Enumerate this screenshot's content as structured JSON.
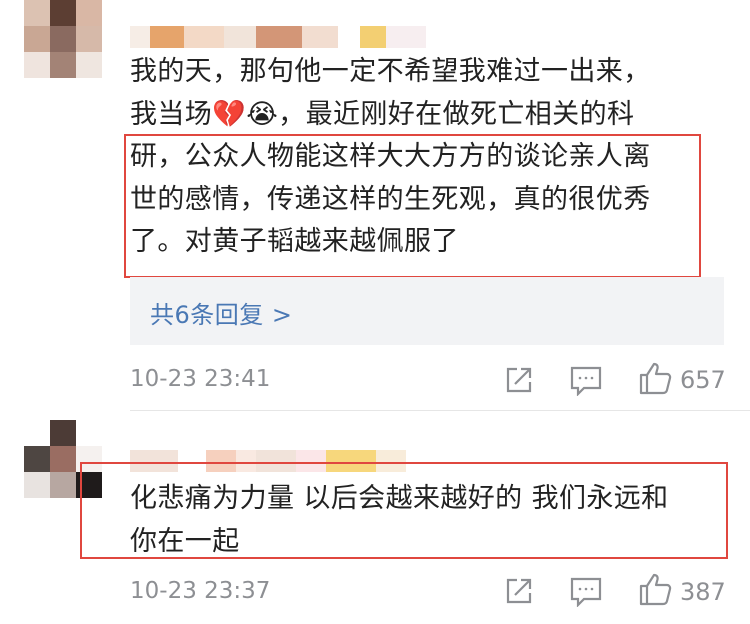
{
  "comments": [
    {
      "text_lines": [
        "我的天，那句他一定不希望我难过一出来，",
        "我当场💔😭，最近刚好在做死亡相关的科",
        "研，公众人物能这样大大方方的谈论亲人离",
        "世的感情，传递这样的生死观，真的很优秀",
        "了。对黄子韬越来越佩服了"
      ],
      "replies_label": "共6条回复 >",
      "timestamp": "10-23 23:41",
      "like_count": "657"
    },
    {
      "text_lines": [
        "化悲痛为力量 以后会越来越好的 我们永远和",
        "你在一起"
      ],
      "timestamp": "10-23 23:37",
      "like_count": "387"
    }
  ],
  "icons": {
    "share": "share-icon",
    "comment": "comment-icon",
    "like": "thumbs-up-icon"
  },
  "colors": {
    "highlight_border": "#e0473f",
    "reply_link": "#4a78b4",
    "meta_text": "#8d8f93"
  }
}
